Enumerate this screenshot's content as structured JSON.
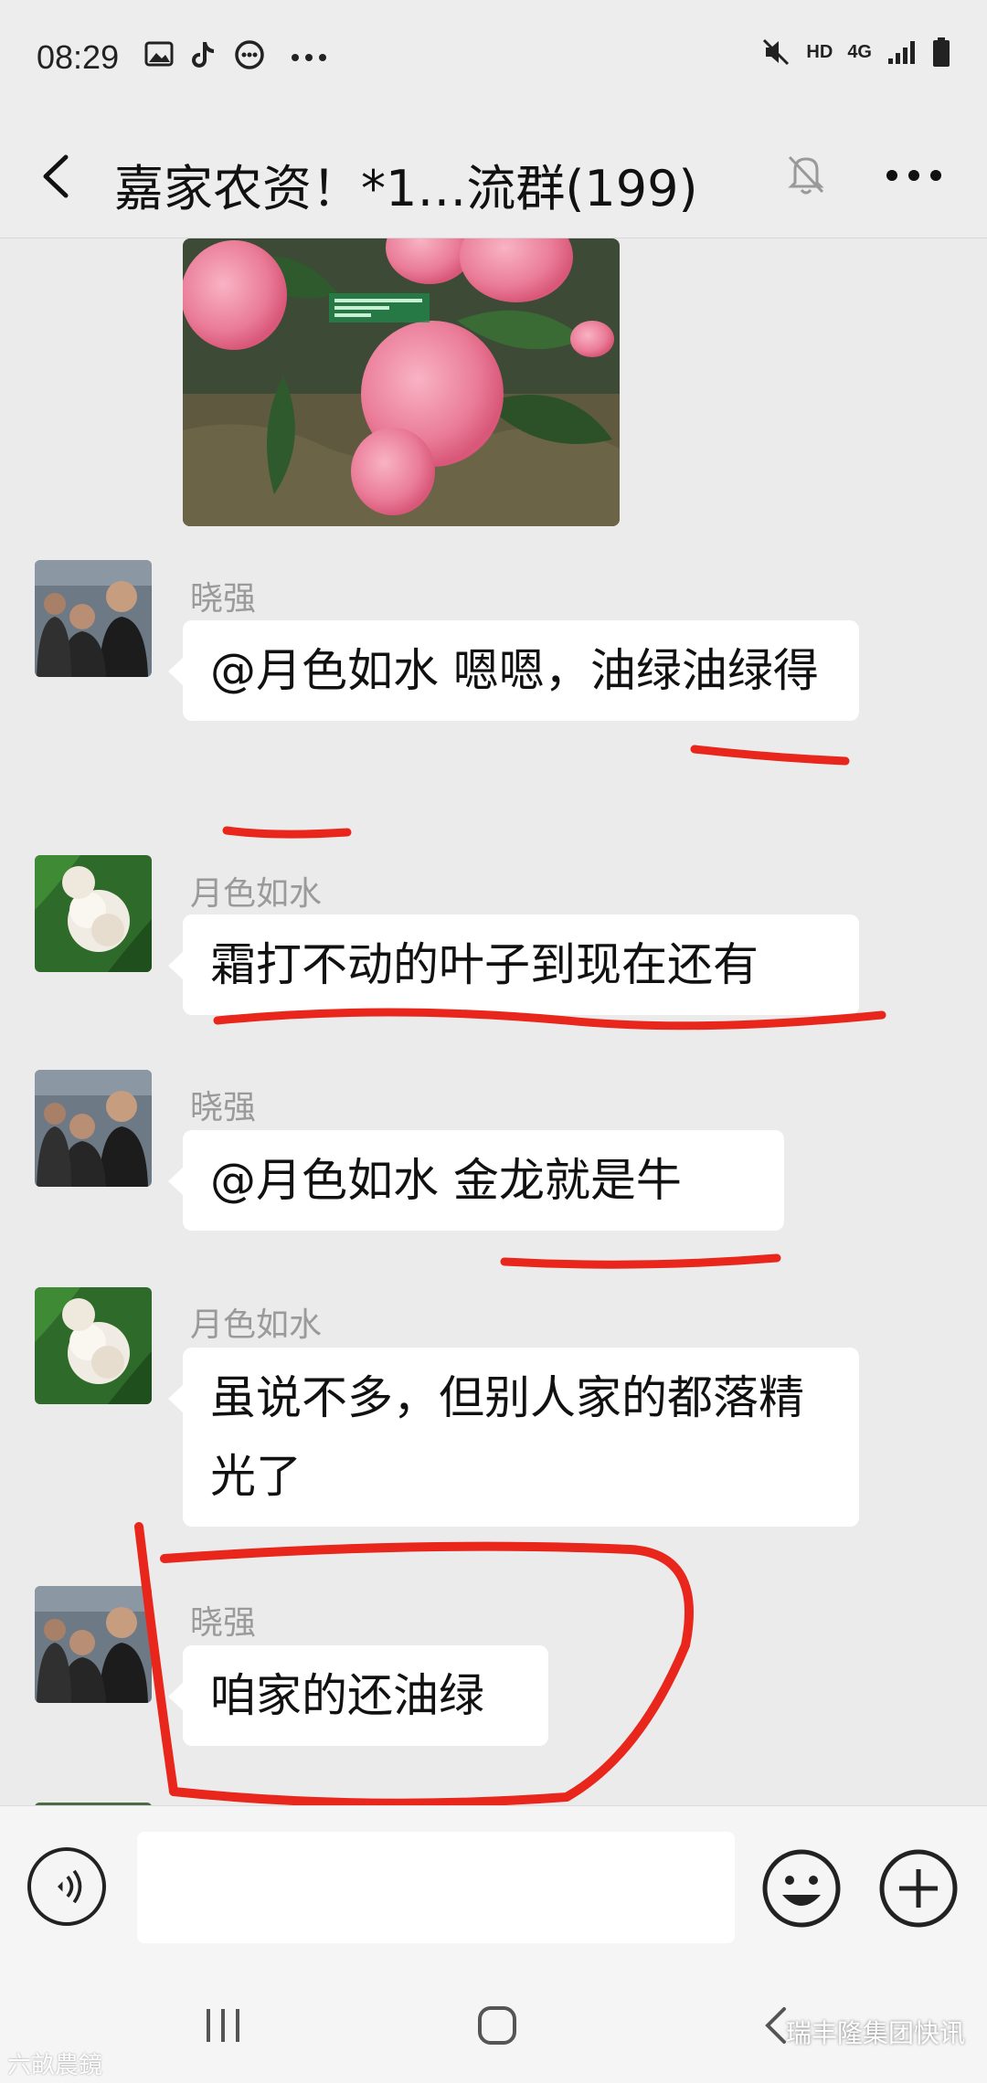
{
  "status_bar": {
    "time": "08:29",
    "left_icons": [
      "gallery-icon",
      "tiktok-icon",
      "chat-icon",
      "more-dots-icon"
    ],
    "network_label": "HD",
    "signal_label": "4G",
    "right_icons": [
      "mute-icon",
      "signal-icon",
      "battery-icon"
    ]
  },
  "header": {
    "title": "嘉家农资！*1…流群(199)",
    "icons": [
      "back-icon",
      "mute-bell-icon",
      "more-icon"
    ]
  },
  "messages": [
    {
      "sender": "晓强",
      "text": "@月色如水  嗯嗯，油绿油绿得"
    },
    {
      "sender": "月色如水",
      "text": "霜打不动的叶子到现在还有"
    },
    {
      "sender": "晓强",
      "text": "@月色如水  金龙就是牛"
    },
    {
      "sender": "月色如水",
      "text": "虽说不多，但别人家的都落精光了"
    },
    {
      "sender": "晓强",
      "text": "咱家的还油绿"
    }
  ],
  "input_bar": {
    "placeholder": "",
    "icons": [
      "voice-icon",
      "emoji-icon",
      "plus-icon"
    ]
  },
  "nav_bar": {
    "icons": [
      "recent-apps-icon",
      "home-icon",
      "back-nav-icon"
    ]
  },
  "watermarks": {
    "left": "六畝農鏡",
    "right": "瑞丰隆集团快讯"
  },
  "colors": {
    "annotation_red": "#e8261c",
    "background": "#ebebeb",
    "bubble": "#ffffff"
  }
}
